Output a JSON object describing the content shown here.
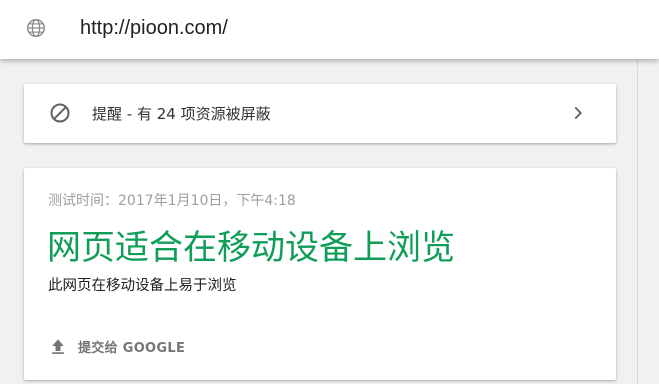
{
  "address_bar": {
    "icon": "globe-icon",
    "url": "http://pioon.com/"
  },
  "alert": {
    "icon": "block-icon",
    "text": "提醒 - 有 24 项资源被屏蔽",
    "action_icon": "chevron-right-icon"
  },
  "result": {
    "test_time": "测试时间：2017年1月10日，下午4:18",
    "headline": "网页适合在移动设备上浏览",
    "description": "此网页在移动设备上易于浏览",
    "submit_icon": "upload-icon",
    "submit_label": "提交给 GOOGLE"
  },
  "colors": {
    "accent_green": "#0f9d58",
    "icon_gray": "#757575",
    "background": "#f1f1f1"
  }
}
